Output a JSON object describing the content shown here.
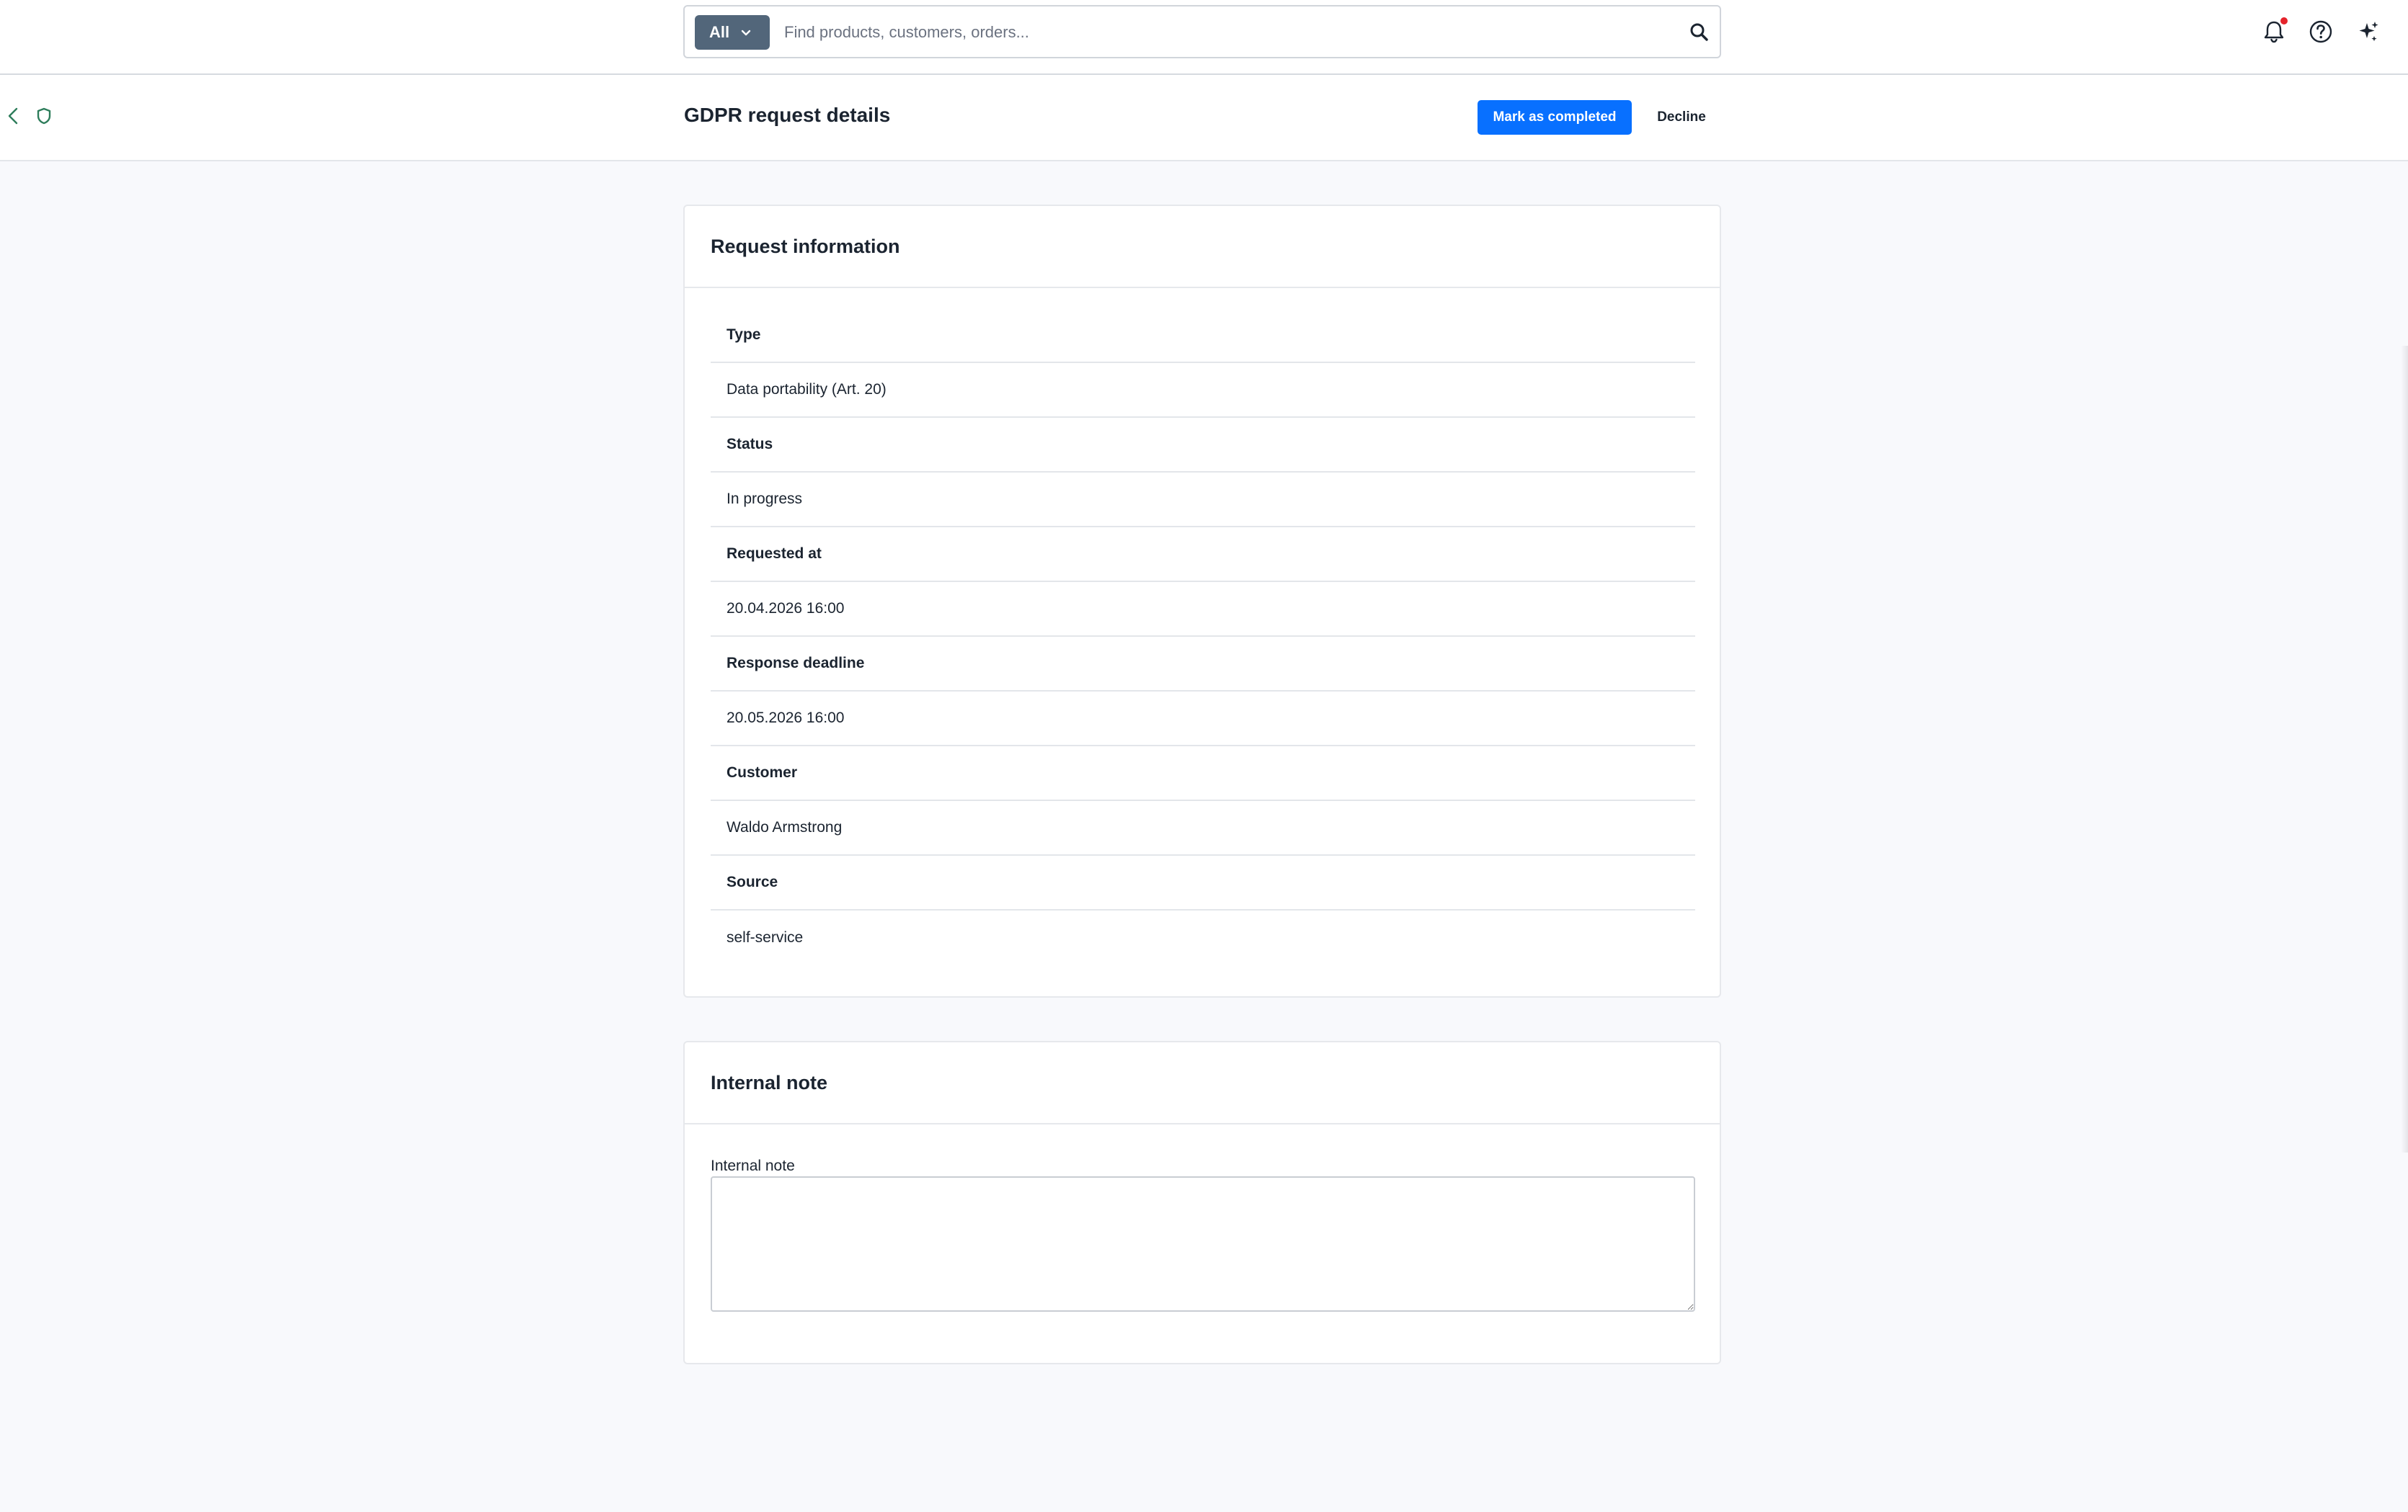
{
  "search": {
    "scope": "All",
    "placeholder": "Find products, customers, orders..."
  },
  "topbar": {
    "icons": [
      "bell-icon",
      "help-icon",
      "sparkle-icon"
    ],
    "notification_dot_color": "#e5242c"
  },
  "header": {
    "title": "GDPR request details",
    "primary_action": "Mark as completed",
    "secondary_action": "Decline",
    "primary_color": "#0870ff"
  },
  "request_info": {
    "title": "Request information",
    "fields": [
      {
        "label": "Type",
        "value": "Data portability (Art. 20)"
      },
      {
        "label": "Status",
        "value": "In progress"
      },
      {
        "label": "Requested at",
        "value": "20.04.2026 16:00"
      },
      {
        "label": "Response deadline",
        "value": "20.05.2026 16:00"
      },
      {
        "label": "Customer",
        "value": "Waldo Armstrong"
      },
      {
        "label": "Source",
        "value": "self-service"
      }
    ]
  },
  "internal_note": {
    "title": "Internal note",
    "field_label": "Internal note",
    "value": ""
  }
}
